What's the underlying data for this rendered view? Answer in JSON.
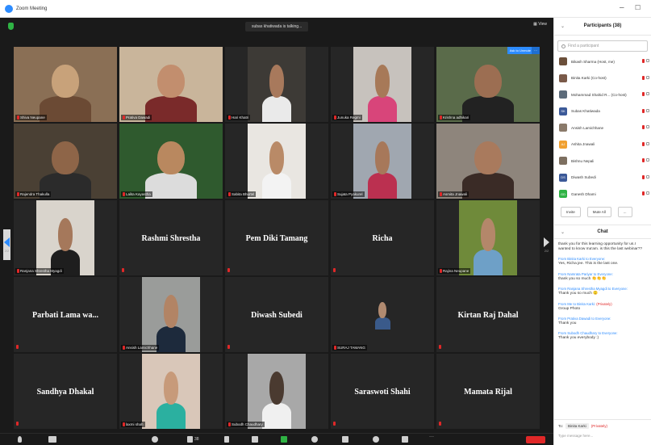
{
  "window": {
    "title": "Zoom Meeting",
    "minimize": "–",
    "maximize": "☐"
  },
  "stage": {
    "talking": "subas khatiwada is talking...",
    "view_label": "View",
    "rename_label": "Ask to Unmute",
    "page_left": "2/2",
    "page_right": "2/2"
  },
  "tiles": [
    {
      "name": "Shiva Neupane",
      "type": "video"
    },
    {
      "name": "Prativa Dawadi",
      "type": "video"
    },
    {
      "name": "Hari Khatri",
      "type": "video"
    },
    {
      "name": "Junuka Regmi",
      "type": "video"
    },
    {
      "name": "Krishna adhikari",
      "type": "video"
    },
    {
      "name": "Rajendra Thakulla",
      "type": "video"
    },
    {
      "name": "Lalita Kayastha",
      "type": "video"
    },
    {
      "name": "Sabita Bhurtel",
      "type": "video"
    },
    {
      "name": "Sujata Pyakurel",
      "type": "video"
    },
    {
      "name": "Asmita Jnawali",
      "type": "video"
    },
    {
      "name": "Ranjana Shrestha Myagdi",
      "type": "video"
    },
    {
      "name": "Rashmi Shrestha",
      "type": "name"
    },
    {
      "name": "Pem Diki Tamang",
      "type": "name"
    },
    {
      "name": "Richa",
      "type": "name"
    },
    {
      "name": "Rajina Neupane",
      "type": "video"
    },
    {
      "name": "Parbati Lama wa...",
      "type": "name"
    },
    {
      "name": "Ansish Lamichhane",
      "type": "video"
    },
    {
      "name": "Diwash Subedi",
      "type": "name"
    },
    {
      "name": "SURAJ TAMANG",
      "type": "video"
    },
    {
      "name": "Kirtan Raj Dahal",
      "type": "name"
    },
    {
      "name": "Sandhya Dhakal",
      "type": "name"
    },
    {
      "name": "laxmi shah",
      "type": "video"
    },
    {
      "name": "Subodh Chaudhary",
      "type": "video"
    },
    {
      "name": "Saraswoti Shahi",
      "type": "name"
    },
    {
      "name": "Mamata Rijal",
      "type": "name"
    }
  ],
  "participants": {
    "title": "Participants (38)",
    "search_placeholder": "Find a participant",
    "list": [
      {
        "name": "Bikash Sharma (Host, me)",
        "avatar": "",
        "color": "#6b4f3a"
      },
      {
        "name": "Binita Karki (Co-host)",
        "avatar": "",
        "color": "#7a5a49"
      },
      {
        "name": "Mohammad Shahid R... (Co-host)",
        "avatar": "",
        "color": "#5c6b7a"
      },
      {
        "name": "Subas Khatiwada",
        "avatar": "SK",
        "color": "#3b5998"
      },
      {
        "name": "Ansish Lamichhane",
        "avatar": "",
        "color": "#8a7a6a"
      },
      {
        "name": "Ashita Jnawali",
        "avatar": "AJ",
        "color": "#f0a030"
      },
      {
        "name": "Bishnu Nepali",
        "avatar": "",
        "color": "#7d6f60"
      },
      {
        "name": "Diwash Subedi",
        "avatar": "DS",
        "color": "#3b5998"
      },
      {
        "name": "Ganesh Dhami",
        "avatar": "GD",
        "color": "#2fb344"
      }
    ],
    "invite_label": "Invite",
    "mute_all_label": "Mute All",
    "more_label": "..."
  },
  "chat": {
    "title": "Chat",
    "messages": [
      {
        "from": "",
        "private": "",
        "text": "thank you for this learning opportunity for us.I wanted to know ma'am. is this the last webinar??"
      },
      {
        "from": "From Binita Karki to Everyone:",
        "private": "",
        "text": "Yes, Richa jee. This is the last one."
      },
      {
        "from": "From Namrata Pariyar to Everyone:",
        "private": "",
        "text": "thank you so much 👏👏👏"
      },
      {
        "from": "From Ranjana Shrestha Myagdi to Everyone:",
        "private": "",
        "text": "Thank you so much 🙂"
      },
      {
        "from": "From Me to Binita Karki:",
        "private": "(Privately)",
        "text": "Group Photo"
      },
      {
        "from": "From Prativa Dawadi to Everyone:",
        "private": "",
        "text": "Thank you"
      },
      {
        "from": "From Subodh Chaudhary to Everyone:",
        "private": "",
        "text": "Thank you everybody :)"
      }
    ],
    "to_label": "To:",
    "to_value": "Binita Karki",
    "to_private": "(Privately)",
    "input_placeholder": "Type message here..."
  },
  "toolbar": {
    "participant_count": "38"
  },
  "colors": {
    "accent": "#2d8cff",
    "end": "#e02828",
    "stage_bg": "#1a1a1a",
    "tile_bg": "#262626"
  }
}
